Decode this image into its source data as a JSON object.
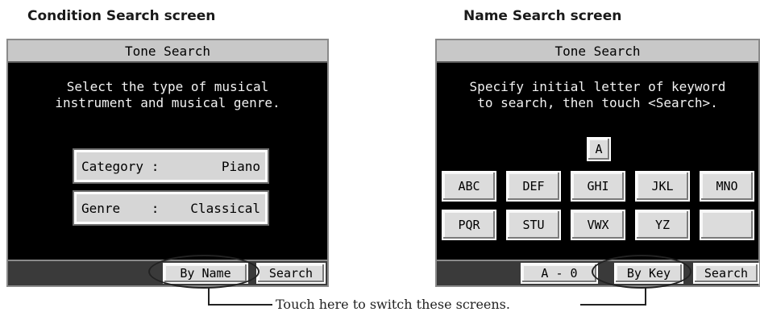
{
  "left": {
    "caption": "Condition Search screen",
    "title": "Tone Search",
    "message": "Select the type of musical\ninstrument and musical genre.",
    "category_label": "Category :",
    "category_value": "Piano",
    "genre_label": "Genre    :",
    "genre_value": "Classical",
    "by_name": "By Name",
    "search": "Search"
  },
  "right": {
    "caption": "Name Search screen",
    "title": "Tone Search",
    "message": "Specify initial letter of keyword\nto search, then touch <Search>.",
    "selected_letter": "A",
    "keys_row1": [
      "ABC",
      "DEF",
      "GHI",
      "JKL",
      "MNO"
    ],
    "keys_row2": [
      "PQR",
      "STU",
      "VWX",
      "YZ",
      ""
    ],
    "a_to_0": "A - 0",
    "by_key": "By Key",
    "search": "Search"
  },
  "note": "Touch here to switch these screens."
}
